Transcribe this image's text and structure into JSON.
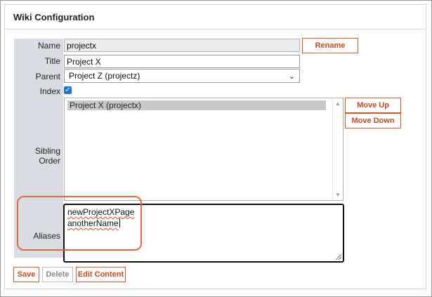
{
  "panel": {
    "title": "Wiki Configuration"
  },
  "form": {
    "name": {
      "label": "Name",
      "value": "projectx",
      "rename_label": "Rename"
    },
    "title": {
      "label": "Title",
      "value": "Project X"
    },
    "parent": {
      "label": "Parent",
      "selected": "Project Z (projectz)"
    },
    "index": {
      "label": "Index",
      "checked": true
    },
    "sibling_order": {
      "label": "Sibling Order",
      "items": [
        "Project X (projectx)"
      ],
      "move_up_label": "Move Up",
      "move_down_label": "Move Down"
    },
    "aliases": {
      "label": "Aliases",
      "lines": [
        "newProjectXPage",
        "anotherName"
      ]
    }
  },
  "actions": {
    "save_label": "Save",
    "delete_label": "Delete",
    "edit_content_label": "Edit Content"
  },
  "colors": {
    "accent": "#d9562b",
    "label_bg": "#d9dde3",
    "highlight": "#e06a3c"
  },
  "icons": [
    "chevron-down-icon",
    "checkmark-icon",
    "scroll-up-icon",
    "scroll-down-icon",
    "resize-handle-icon"
  ]
}
